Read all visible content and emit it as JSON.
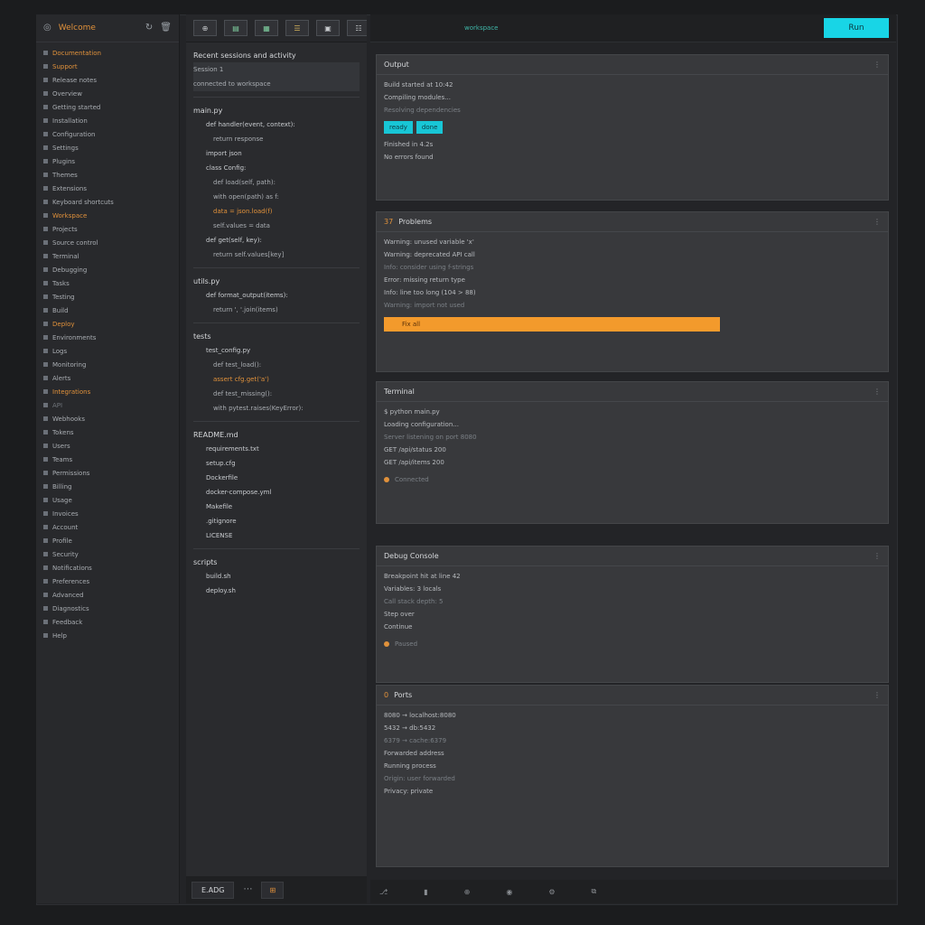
{
  "sidebar": {
    "title": "Welcome",
    "items": [
      {
        "label": "Documentation",
        "style": "accent"
      },
      {
        "label": "Support",
        "style": "accent"
      },
      {
        "label": "Release notes"
      },
      {
        "label": "Overview"
      },
      {
        "label": "Getting started"
      },
      {
        "label": "Installation"
      },
      {
        "label": "Configuration"
      },
      {
        "label": "Settings"
      },
      {
        "label": "Plugins"
      },
      {
        "label": "Themes"
      },
      {
        "label": "Extensions"
      },
      {
        "label": "Keyboard shortcuts"
      },
      {
        "label": "Workspace",
        "style": "accent"
      },
      {
        "label": "Projects"
      },
      {
        "label": "Source control"
      },
      {
        "label": "Terminal"
      },
      {
        "label": "Debugging"
      },
      {
        "label": "Tasks"
      },
      {
        "label": "Testing"
      },
      {
        "label": "Build"
      },
      {
        "label": "Deploy",
        "style": "accent"
      },
      {
        "label": "Environments"
      },
      {
        "label": "Logs"
      },
      {
        "label": "Monitoring"
      },
      {
        "label": "Alerts"
      },
      {
        "label": "Integrations",
        "style": "accent"
      },
      {
        "label": "API",
        "style": "dim"
      },
      {
        "label": "Webhooks"
      },
      {
        "label": "Tokens"
      },
      {
        "label": "Users"
      },
      {
        "label": "Teams"
      },
      {
        "label": "Permissions"
      },
      {
        "label": "Billing"
      },
      {
        "label": "Usage"
      },
      {
        "label": "Invoices"
      },
      {
        "label": "Account"
      },
      {
        "label": "Profile"
      },
      {
        "label": "Security"
      },
      {
        "label": "Notifications"
      },
      {
        "label": "Preferences"
      },
      {
        "label": "Advanced"
      },
      {
        "label": "Diagnostics"
      },
      {
        "label": "Feedback"
      },
      {
        "label": "Help"
      }
    ]
  },
  "midcol": {
    "toolbar": [
      "⊕",
      "▤",
      "▦",
      "☰",
      "▣",
      "☷"
    ],
    "rows": [
      {
        "label": "Recent sessions and activity",
        "type": "head"
      },
      {
        "label": "Session 1",
        "type": "sel"
      },
      {
        "label": "connected to workspace",
        "type": "sel"
      },
      {
        "label": "main.py",
        "type": "head"
      },
      {
        "label": "def handler(event, context):",
        "type": "code"
      },
      {
        "label": "return response",
        "type": "code2"
      },
      {
        "label": "import json",
        "type": "code"
      },
      {
        "label": "class Config:",
        "type": "code"
      },
      {
        "label": "def load(self, path):",
        "type": "code2"
      },
      {
        "label": "with open(path) as f:",
        "type": "code2"
      },
      {
        "label": "data = json.load(f)",
        "type": "code2",
        "hl": true
      },
      {
        "label": "self.values = data",
        "type": "code2"
      },
      {
        "label": "def get(self, key):",
        "type": "code"
      },
      {
        "label": "return self.values[key]",
        "type": "code2"
      },
      {
        "label": "utils.py",
        "type": "head"
      },
      {
        "label": "def format_output(items):",
        "type": "code"
      },
      {
        "label": "return ', '.join(items)",
        "type": "code2"
      },
      {
        "label": "tests",
        "type": "head"
      },
      {
        "label": "test_config.py",
        "type": "code"
      },
      {
        "label": "def test_load():",
        "type": "code2"
      },
      {
        "label": "assert cfg.get('a')",
        "type": "code2",
        "hl": true
      },
      {
        "label": "def test_missing():",
        "type": "code2"
      },
      {
        "label": "with pytest.raises(KeyError):",
        "type": "code2"
      },
      {
        "label": "README.md",
        "type": "head"
      },
      {
        "label": "requirements.txt",
        "type": "code"
      },
      {
        "label": "setup.cfg",
        "type": "code"
      },
      {
        "label": "Dockerfile",
        "type": "code"
      },
      {
        "label": "docker-compose.yml",
        "type": "code"
      },
      {
        "label": "Makefile",
        "type": "code"
      },
      {
        "label": ".gitignore",
        "type": "code"
      },
      {
        "label": "LICENSE",
        "type": "code"
      },
      {
        "label": "scripts",
        "type": "head"
      },
      {
        "label": "build.sh",
        "type": "code"
      },
      {
        "label": "deploy.sh",
        "type": "code"
      }
    ],
    "bottom_left": "E.ADG",
    "bottom_right": "⊞"
  },
  "topbar": {
    "title": "workspace",
    "cta": "Run"
  },
  "cards": [
    {
      "num": "",
      "title": "Output",
      "lines": [
        "Build started at 10:42",
        "Compiling modules...",
        "Resolving dependencies"
      ],
      "bar": [
        "ready",
        "done"
      ],
      "tail": [
        "Finished in 4.2s",
        "No errors found"
      ]
    },
    {
      "num": "37",
      "title": "Problems",
      "lines": [
        "Warning: unused variable 'x'",
        "Warning: deprecated API call",
        "Info: consider using f-strings",
        "Error: missing return type",
        "Info: line too long (104 > 88)",
        "Warning: import not used"
      ],
      "orange": "Fix all"
    },
    {
      "num": "",
      "title": "Terminal",
      "lines": [
        "$ python main.py",
        "Loading configuration...",
        "Server listening on port 8080",
        "GET /api/status 200",
        "GET /api/items 200"
      ],
      "foot": "Connected"
    },
    {
      "num": "",
      "title": "Debug Console",
      "lines": [
        "Breakpoint hit at line 42",
        "Variables: 3 locals",
        "Call stack depth: 5",
        "Step over",
        "Continue"
      ],
      "foot": "Paused"
    },
    {
      "num": "0",
      "title": "Ports",
      "lines": [
        "8080 → localhost:8080",
        "5432 → db:5432",
        "6379 → cache:6379",
        "Forwarded address",
        "Running process",
        "Origin: user forwarded",
        "Privacy: private"
      ]
    }
  ],
  "status": {
    "items": [
      "⎇",
      "▮",
      "⊕",
      "◉",
      "⚙",
      "⧉"
    ]
  },
  "colors": {
    "accent": "#e0913b",
    "cyan": "#18d5e6",
    "orange": "#f39a2c"
  }
}
